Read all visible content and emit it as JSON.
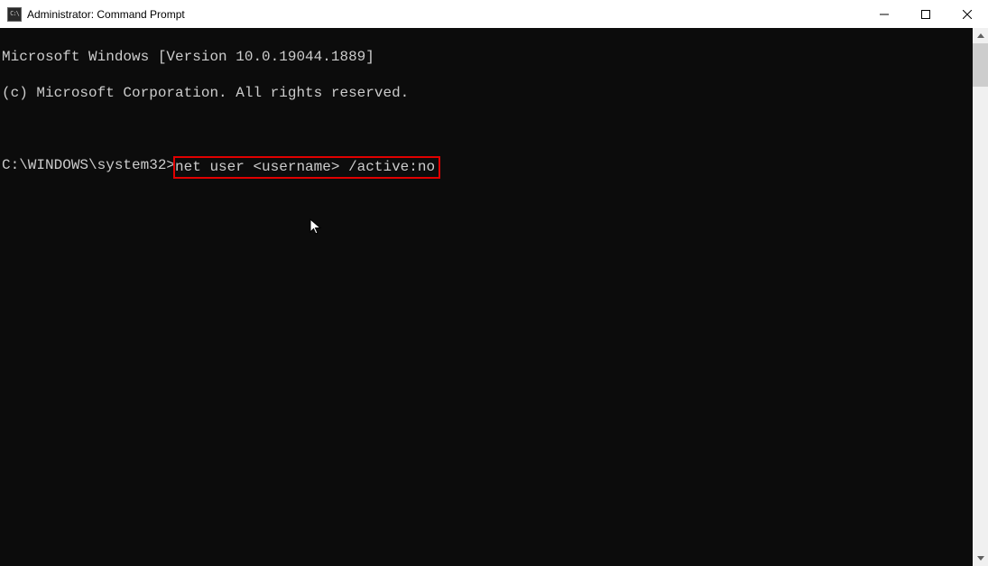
{
  "window": {
    "title": "Administrator: Command Prompt",
    "icon_label": "C:\\"
  },
  "console": {
    "line1": "Microsoft Windows [Version 10.0.19044.1889]",
    "line2": "(c) Microsoft Corporation. All rights reserved.",
    "prompt": "C:\\WINDOWS\\system32>",
    "command": "net user <username> /active:no"
  }
}
